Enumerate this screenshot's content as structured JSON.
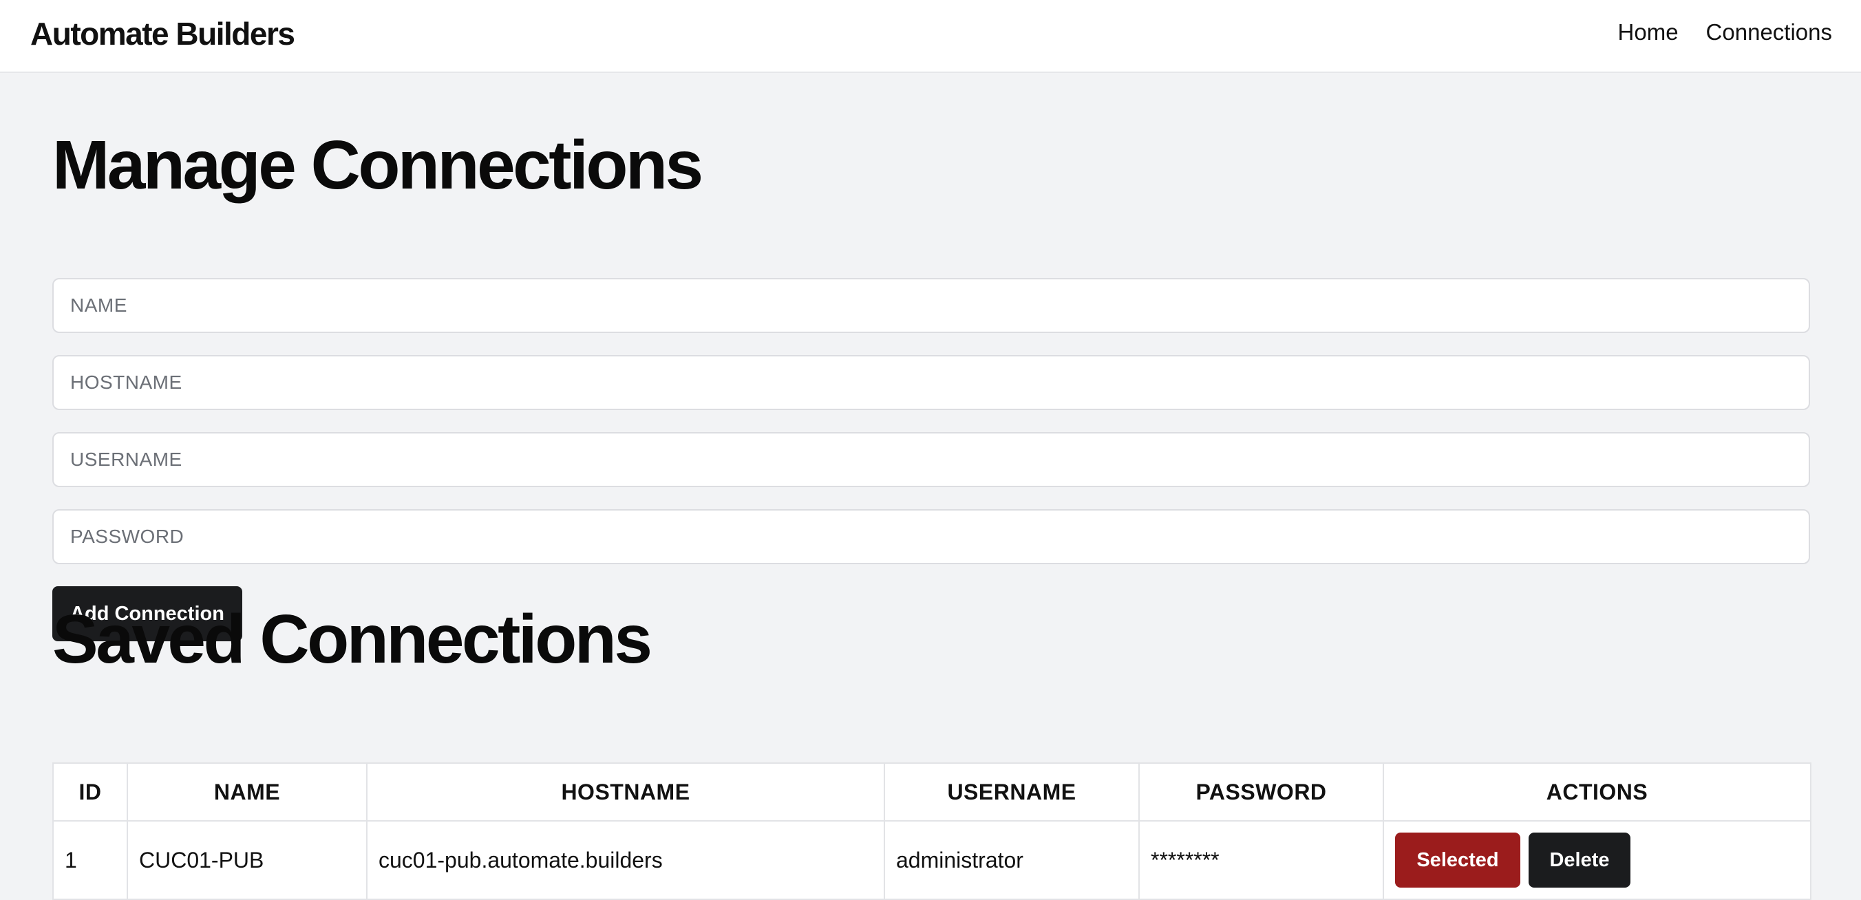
{
  "header": {
    "brand": "Automate Builders",
    "nav": [
      {
        "label": "Home"
      },
      {
        "label": "Connections"
      }
    ]
  },
  "form": {
    "title": "Manage Connections",
    "fields": {
      "name": {
        "placeholder": "NAME",
        "value": ""
      },
      "hostname": {
        "placeholder": "HOSTNAME",
        "value": ""
      },
      "username": {
        "placeholder": "USERNAME",
        "value": ""
      },
      "password": {
        "placeholder": "PASSWORD",
        "value": ""
      }
    },
    "submit_label": "Add Connection"
  },
  "saved": {
    "title": "Saved Connections",
    "columns": [
      "ID",
      "NAME",
      "HOSTNAME",
      "USERNAME",
      "PASSWORD",
      "ACTIONS"
    ],
    "rows": [
      {
        "id": "1",
        "name": "CUC01-PUB",
        "hostname": "cuc01-pub.automate.builders",
        "username": "administrator",
        "password": "********",
        "actions": {
          "selected_label": "Selected",
          "delete_label": "Delete"
        }
      }
    ]
  },
  "colors": {
    "page_bg": "#f2f3f5",
    "primary_button": "#1b1c1e",
    "selected_button": "#9b1c1c"
  }
}
